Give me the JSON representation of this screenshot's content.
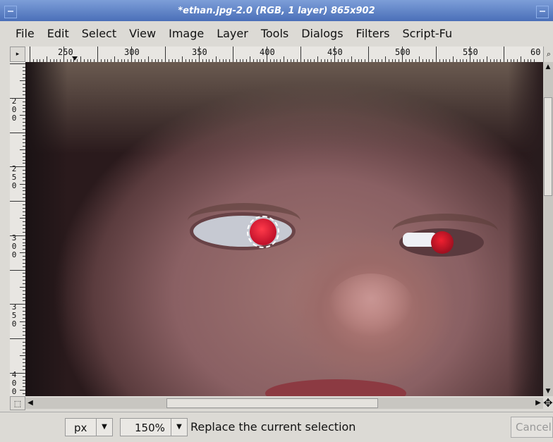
{
  "window": {
    "title": "*ethan.jpg-2.0 (RGB, 1 layer) 865x902"
  },
  "menu": [
    "File",
    "Edit",
    "Select",
    "View",
    "Image",
    "Layer",
    "Tools",
    "Dialogs",
    "Filters",
    "Script-Fu"
  ],
  "hruler": {
    "labels": [
      "250",
      "300",
      "350",
      "400",
      "450",
      "500",
      "550",
      "60"
    ]
  },
  "vruler": {
    "labels": [
      "2\n0\n0",
      "2\n5\n0",
      "3\n0\n0",
      "3\n5\n0",
      "4\n0\n0"
    ]
  },
  "status": {
    "unit": "px",
    "zoom": "150%",
    "message": "Replace the current selection",
    "cancel_label": "Cancel"
  },
  "icons": {
    "corner": "ruler-corner-icon",
    "zoom_nav": "zoom-icon",
    "quickmask": "quick-mask-icon",
    "navigate": "navigate-icon"
  }
}
